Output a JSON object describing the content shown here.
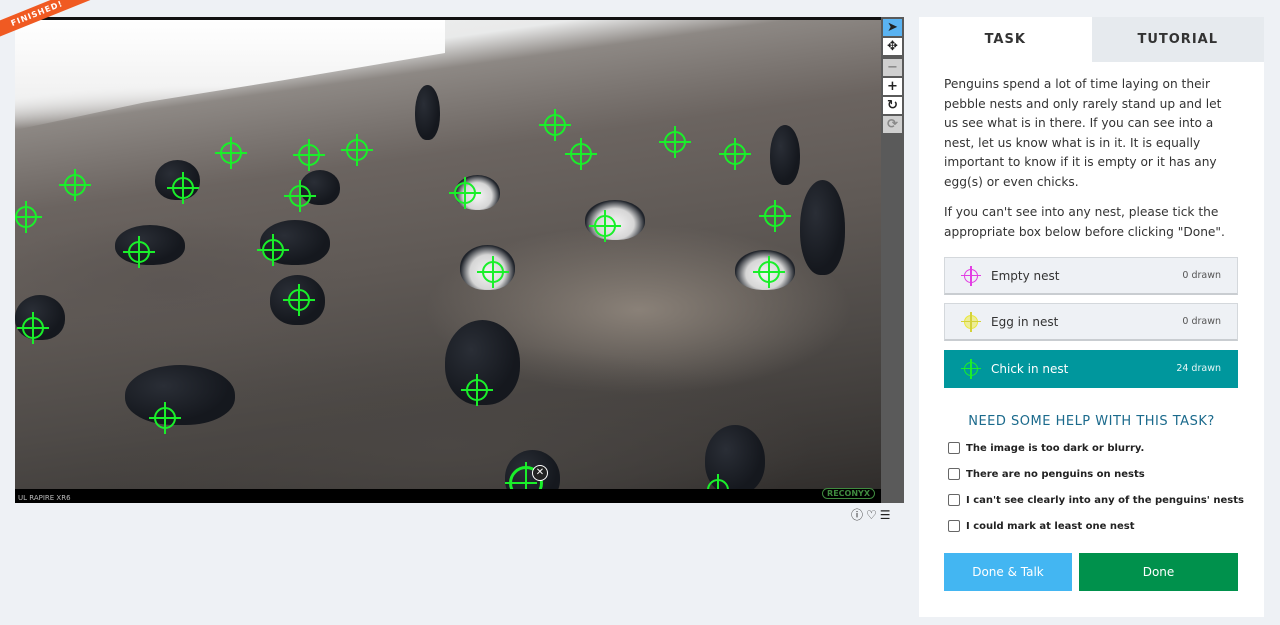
{
  "viewer": {
    "badge": "FINISHED!",
    "camera_label": "UL RAPIRE XR6",
    "camera_brand": "RECONYX"
  },
  "tools": [
    "pointer-icon",
    "move-icon",
    "zoom-out-icon",
    "zoom-in-icon",
    "rotate-icon",
    "reset-icon"
  ],
  "tabs": [
    {
      "label": "TASK",
      "active": true
    },
    {
      "label": "TUTORIAL",
      "active": false
    }
  ],
  "instructions": {
    "p1": "Penguins spend a lot of time laying on their pebble nests and only rarely stand up and let us see what is in there. If you can see into a nest, let us know what is in it. It is equally important to know if it is empty or it has any egg(s) or even chicks.",
    "p2": "If you can't see into any nest, please tick the appropriate box below before clicking \"Done\"."
  },
  "drawing_tools": [
    {
      "label": "Empty nest",
      "count": "0 drawn",
      "color": "#e23ee3",
      "active": false
    },
    {
      "label": "Egg in nest",
      "count": "0 drawn",
      "color": "#ebe93b",
      "active": false
    },
    {
      "label": "Chick in nest",
      "count": "24 drawn",
      "color": "#1aef2a",
      "active": true
    }
  ],
  "help": {
    "title": "NEED SOME HELP WITH THIS TASK?",
    "options": [
      {
        "label": "The image is too dark or blurry.",
        "checked": false
      },
      {
        "label": "There are no penguins on nests",
        "checked": false
      },
      {
        "label": "I can't see clearly into any of the penguins' nests",
        "checked": false
      },
      {
        "label": "I could mark at least one nest",
        "checked": false
      }
    ]
  },
  "actions": {
    "done_talk": "Done & Talk",
    "done": "Done"
  },
  "colors": {
    "accent": "#00979d",
    "done": "#00914c",
    "talk": "#43b6f2",
    "marker": "#1aef2a"
  }
}
